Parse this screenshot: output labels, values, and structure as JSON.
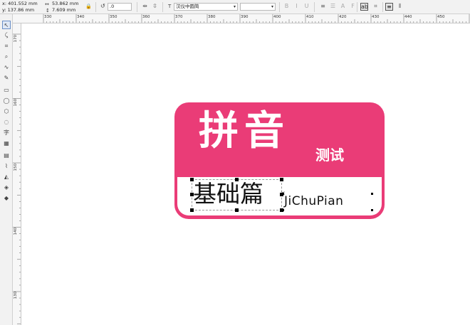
{
  "propbar": {
    "x": "x: 401.552 mm",
    "y": "y: 137.86 mm",
    "width": "53.862 mm",
    "height": "7.609 mm",
    "rotation": ".0",
    "font_name": "汉仪中圆简",
    "font_size": ""
  },
  "hruler": {
    "labels": [
      "330",
      "340",
      "350",
      "360",
      "370",
      "380",
      "390",
      "400",
      "410",
      "420",
      "430",
      "440",
      "450"
    ]
  },
  "vruler": {
    "labels": [
      "170",
      "160",
      "150",
      "140",
      "130"
    ]
  },
  "artwork": {
    "big_title": "拼音",
    "small_title": "测试",
    "subtitle": "基础篇",
    "pinyin": "JiChuPian",
    "center_mark": "×"
  },
  "colors": {
    "card": "#ea3c77",
    "selection_handles": "#000000"
  }
}
